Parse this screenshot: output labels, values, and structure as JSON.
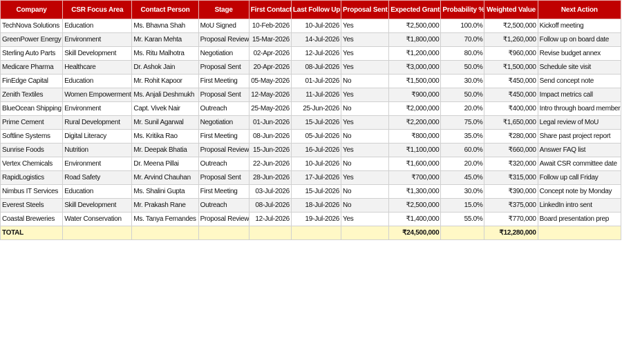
{
  "headers": [
    "Company",
    "CSR Focus Area",
    "Contact Person",
    "Stage",
    "First Contact",
    "Last Follow Up",
    "Proposal Sent",
    "Expected Grant",
    "Probability %",
    "Weighted Value",
    "Next Action"
  ],
  "rows": [
    [
      "TechNova Solutions",
      "Education",
      "Ms. Bhavna Shah",
      "MoU Signed",
      "10-Feb-2026",
      "10-Jul-2026",
      "Yes",
      "₹2,500,000",
      "100.0%",
      "₹2,500,000",
      "Kickoff meeting"
    ],
    [
      "GreenPower Energy",
      "Environment",
      "Mr. Karan Mehta",
      "Proposal Review",
      "15-Mar-2026",
      "14-Jul-2026",
      "Yes",
      "₹1,800,000",
      "70.0%",
      "₹1,260,000",
      "Follow up on board date"
    ],
    [
      "Sterling Auto Parts",
      "Skill Development",
      "Ms. Ritu Malhotra",
      "Negotiation",
      "02-Apr-2026",
      "12-Jul-2026",
      "Yes",
      "₹1,200,000",
      "80.0%",
      "₹960,000",
      "Revise budget annex"
    ],
    [
      "Medicare Pharma",
      "Healthcare",
      "Dr. Ashok Jain",
      "Proposal Sent",
      "20-Apr-2026",
      "08-Jul-2026",
      "Yes",
      "₹3,000,000",
      "50.0%",
      "₹1,500,000",
      "Schedule site visit"
    ],
    [
      "FinEdge Capital",
      "Education",
      "Mr. Rohit Kapoor",
      "First Meeting",
      "05-May-2026",
      "01-Jul-2026",
      "No",
      "₹1,500,000",
      "30.0%",
      "₹450,000",
      "Send concept note"
    ],
    [
      "Zenith Textiles",
      "Women Empowerment",
      "Ms. Anjali Deshmukh",
      "Proposal Sent",
      "12-May-2026",
      "11-Jul-2026",
      "Yes",
      "₹900,000",
      "50.0%",
      "₹450,000",
      "Impact metrics call"
    ],
    [
      "BlueOcean Shipping",
      "Environment",
      "Capt. Vivek Nair",
      "Outreach",
      "25-May-2026",
      "25-Jun-2026",
      "No",
      "₹2,000,000",
      "20.0%",
      "₹400,000",
      "Intro through board member"
    ],
    [
      "Prime Cement",
      "Rural Development",
      "Mr. Sunil Agarwal",
      "Negotiation",
      "01-Jun-2026",
      "15-Jul-2026",
      "Yes",
      "₹2,200,000",
      "75.0%",
      "₹1,650,000",
      "Legal review of MoU"
    ],
    [
      "Softline Systems",
      "Digital Literacy",
      "Ms. Kritika Rao",
      "First Meeting",
      "08-Jun-2026",
      "05-Jul-2026",
      "No",
      "₹800,000",
      "35.0%",
      "₹280,000",
      "Share past project report"
    ],
    [
      "Sunrise Foods",
      "Nutrition",
      "Mr. Deepak Bhatia",
      "Proposal Review",
      "15-Jun-2026",
      "16-Jul-2026",
      "Yes",
      "₹1,100,000",
      "60.0%",
      "₹660,000",
      "Answer FAQ list"
    ],
    [
      "Vertex Chemicals",
      "Environment",
      "Dr. Meena Pillai",
      "Outreach",
      "22-Jun-2026",
      "10-Jul-2026",
      "No",
      "₹1,600,000",
      "20.0%",
      "₹320,000",
      "Await CSR committee date"
    ],
    [
      "RapidLogistics",
      "Road Safety",
      "Mr. Arvind Chauhan",
      "Proposal Sent",
      "28-Jun-2026",
      "17-Jul-2026",
      "Yes",
      "₹700,000",
      "45.0%",
      "₹315,000",
      "Follow up call Friday"
    ],
    [
      "Nimbus IT Services",
      "Education",
      "Ms. Shalini Gupta",
      "First Meeting",
      "03-Jul-2026",
      "15-Jul-2026",
      "No",
      "₹1,300,000",
      "30.0%",
      "₹390,000",
      "Concept note by Monday"
    ],
    [
      "Everest Steels",
      "Skill Development",
      "Mr. Prakash Rane",
      "Outreach",
      "08-Jul-2026",
      "18-Jul-2026",
      "No",
      "₹2,500,000",
      "15.0%",
      "₹375,000",
      "LinkedIn intro sent"
    ],
    [
      "Coastal Breweries",
      "Water Conservation",
      "Ms. Tanya Fernandes",
      "Proposal Review",
      "12-Jul-2026",
      "19-Jul-2026",
      "Yes",
      "₹1,400,000",
      "55.0%",
      "₹770,000",
      "Board presentation prep"
    ]
  ],
  "total": {
    "label": "TOTAL",
    "expected_grant": "₹24,500,000",
    "weighted_value": "₹12,280,000"
  },
  "colors": {
    "header_bg": "#c00000",
    "header_text": "#ffffff",
    "band_row": "#f2f2f2",
    "total_row": "#fff8c6"
  }
}
